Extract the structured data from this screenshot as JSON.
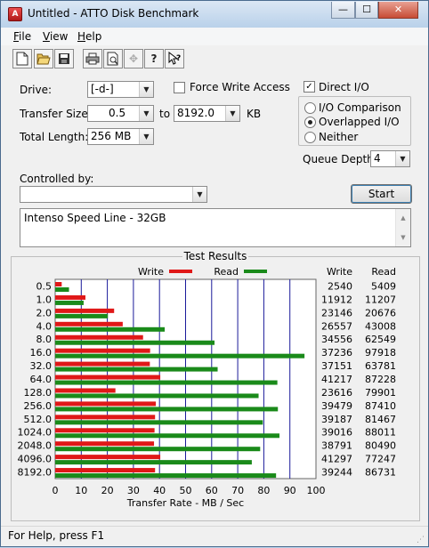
{
  "window": {
    "title": "Untitled - ATTO Disk Benchmark"
  },
  "titlebar_buttons": {
    "minimize": "—",
    "maximize": "☐",
    "close": "✕"
  },
  "menu": [
    {
      "label": "File",
      "accel": "F"
    },
    {
      "label": "View",
      "accel": "V"
    },
    {
      "label": "Help",
      "accel": "H"
    }
  ],
  "toolbar": {
    "icons": [
      "new-icon",
      "open-icon",
      "save-icon",
      "print-icon",
      "print-preview-icon",
      "move-icon",
      "help-icon",
      "context-help-icon"
    ]
  },
  "form": {
    "drive_label": "Drive:",
    "drive_value": "[-d-]",
    "force_write_label": "Force Write Access",
    "direct_io_label": "Direct I/O",
    "direct_io_checked": true,
    "transfer_size_label": "Transfer Size:",
    "transfer_from": "0.5",
    "to_label": "to",
    "transfer_to": "8192.0",
    "kb_label": "KB",
    "total_length_label": "Total Length:",
    "total_length_value": "256 MB",
    "io_comparison_label": "I/O Comparison",
    "overlapped_io_label": "Overlapped I/O",
    "neither_label": "Neither",
    "queue_depth_label": "Queue Depth:",
    "queue_depth_value": "4",
    "controlled_by_label": "Controlled by:",
    "controlled_by_value": "",
    "start_label": "Start",
    "description": "Intenso Speed Line - 32GB"
  },
  "results": {
    "title": "Test Results",
    "legend_write": "Write",
    "legend_read": "Read",
    "col_write": "Write",
    "col_read": "Read",
    "write_color": "#e01818",
    "read_color": "#1a8a1a",
    "xlabel": "Transfer Rate - MB / Sec"
  },
  "chart_data": {
    "type": "bar",
    "orientation": "horizontal",
    "categories": [
      "0.5",
      "1.0",
      "2.0",
      "4.0",
      "8.0",
      "16.0",
      "32.0",
      "64.0",
      "128.0",
      "256.0",
      "512.0",
      "1024.0",
      "2048.0",
      "4096.0",
      "8192.0"
    ],
    "series": [
      {
        "name": "Write",
        "values": [
          2.5,
          11.6,
          22.6,
          25.9,
          33.7,
          36.4,
          36.3,
          40.3,
          23.1,
          38.6,
          38.3,
          38.1,
          37.9,
          40.3,
          38.3
        ],
        "table": [
          "2540",
          "11912",
          "23146",
          "26557",
          "34556",
          "37236",
          "37151",
          "41217",
          "23616",
          "39479",
          "39187",
          "39016",
          "38791",
          "41297",
          "39244"
        ]
      },
      {
        "name": "Read",
        "values": [
          5.3,
          10.9,
          20.2,
          42.0,
          61.1,
          95.6,
          62.3,
          85.2,
          78.0,
          85.4,
          79.6,
          86.0,
          78.6,
          75.4,
          84.7
        ],
        "table": [
          "5409",
          "11207",
          "20676",
          "43008",
          "62549",
          "97918",
          "63781",
          "87228",
          "79901",
          "87410",
          "81467",
          "88011",
          "80490",
          "77247",
          "86731"
        ]
      }
    ],
    "x_ticks": [
      "0",
      "10",
      "20",
      "30",
      "40",
      "50",
      "60",
      "70",
      "80",
      "90",
      "100"
    ],
    "xlim": [
      0,
      100
    ],
    "xlabel": "Transfer Rate - MB / Sec",
    "grid": true
  },
  "status": {
    "text": "For Help, press F1"
  }
}
